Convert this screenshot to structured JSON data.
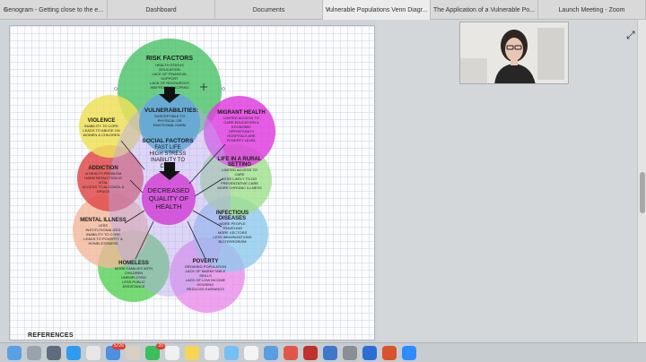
{
  "tabs": [
    {
      "label": "Genogram - Getting close to the e...",
      "active": false
    },
    {
      "label": "Dashboard",
      "active": false
    },
    {
      "label": "Documents",
      "active": false
    },
    {
      "label": "Vulnerable Populations Venn Diagr...",
      "active": true
    },
    {
      "label": "The Application of a Vulnerable Po...",
      "active": false
    },
    {
      "label": "Launch Meeting - Zoom",
      "active": false
    }
  ],
  "diagram": {
    "risk_factors": {
      "title": "RISK FACTORS",
      "lines": [
        "HEALTH STATUS",
        "EDUCATION",
        "LACK OF FINANCIAL",
        "SUPPORT",
        "LACK OF RESOURCES",
        "INEFFECTIVE COPING"
      ],
      "color": "#52c46e"
    },
    "vulnerabilities": {
      "title": "VULNERABILITIES:",
      "lines": [
        "SUSCEPTIBLE TO",
        "PHYSICAL OR",
        "EMOTIONAL HARM"
      ],
      "color": "#62a7d8"
    },
    "social_factors": {
      "lines": [
        "SOCIAL FACTORS",
        "FAST LIFE",
        "HIGH STRESS",
        "INABILITY TO",
        "COPE"
      ]
    },
    "decreased": {
      "lines": [
        "DECREASED",
        "QUALITY OF",
        "HEALTH"
      ],
      "color": "#d24ad7"
    },
    "violence": {
      "title": "VIOLENCE",
      "lines": [
        "INABILITY TO COPE",
        "LEADS TO ABUSE ON",
        "WOMEN & CHILDREN"
      ],
      "color": "#efe05a"
    },
    "addiction": {
      "title": "ADDICTION",
      "lines": [
        "of HEALTH PROBLEM",
        "HARM REDUCTION IS",
        "VITAL",
        "ACCESS TO ALCOHOL &",
        "DRUGS"
      ],
      "color": "#e04b4b"
    },
    "mental_illness": {
      "title": "MENTAL ILLNESS",
      "lines": [
        "LESS",
        "INSTITUTIONALIZED",
        "INABILITY TO COPE",
        "LEADS TO POVERTY &",
        "HOMELESSNESS"
      ],
      "color": "#f3b899"
    },
    "homeless": {
      "title": "HOMELESS",
      "lines": [
        "MORE FAMILIES WITH",
        "CHILDREN",
        "UNEMPLOYED",
        "LESS PUBLIC",
        "ASSISTANCE"
      ],
      "color": "#5fd45f"
    },
    "poverty": {
      "title": "POVERTY",
      "lines": [
        "GROWING POPULATION",
        "LACK OF MARKETABLE",
        "SKILLS",
        "LACK OF LOW INCOME",
        "HOUSING",
        "REDUCED EARNINGS"
      ],
      "color": "#ea86ea"
    },
    "infectious": {
      "title": "INFECTIOUS",
      "title2": "DISEASES",
      "lines": [
        "MORE PEOPLE",
        "TRAVELING",
        "MORE VECTORS",
        "LESS IMMUNIZATIONS",
        "BIOTERRORISM"
      ],
      "color": "#8fc9ec"
    },
    "rural": {
      "title": "LIFE IN A RURAL",
      "title2": "SETTING",
      "lines": [
        "LIMITED ACCESS TO",
        "CARE",
        "LESS LIKELY TO DO",
        "PREVENTATIVE CARE",
        "MORE CHRONIC ILLNESS"
      ],
      "color": "#9fe08c"
    },
    "migrant": {
      "title": "MIGRANT HEALTH",
      "lines": [
        "LIMITED ACCESS TO",
        "CARE EDUCATION &",
        "ECONOMIC",
        "OPPORTUNITY",
        "HOSPITALS ARE",
        "POVERTY LEVEL"
      ],
      "color": "#e040e0"
    }
  },
  "references_label": "REFERENCES",
  "dock": {
    "badge_mail": "5726",
    "badge_messages": "20"
  }
}
